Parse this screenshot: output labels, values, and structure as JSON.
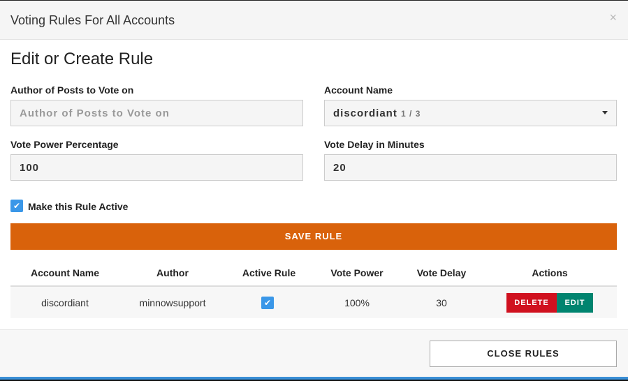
{
  "modal": {
    "title": "Voting Rules For All Accounts",
    "close_symbol": "×"
  },
  "form": {
    "heading": "Edit or Create Rule",
    "author_label": "Author of Posts to Vote on",
    "author_placeholder": "Author of Posts to Vote on",
    "account_label": "Account Name",
    "account_value": "discordiant",
    "account_count": "1 / 3",
    "power_label": "Vote Power Percentage",
    "power_value": "100",
    "delay_label": "Vote Delay in Minutes",
    "delay_value": "20",
    "active_label": "Make this Rule Active",
    "active_checked": true,
    "save_label": "SAVE RULE"
  },
  "table": {
    "headers": [
      "Account Name",
      "Author",
      "Active Rule",
      "Vote Power",
      "Vote Delay",
      "Actions"
    ],
    "rows": [
      {
        "account": "discordiant",
        "author": "minnowsupport",
        "active": true,
        "power": "100%",
        "delay": "30",
        "delete_label": "DELETE",
        "edit_label": "EDIT"
      }
    ]
  },
  "footer": {
    "close_label": "CLOSE RULES"
  },
  "colors": {
    "accent": "#d9620b",
    "delete": "#d0111f",
    "edit": "#00846f",
    "checkbox": "#3a97e8"
  }
}
